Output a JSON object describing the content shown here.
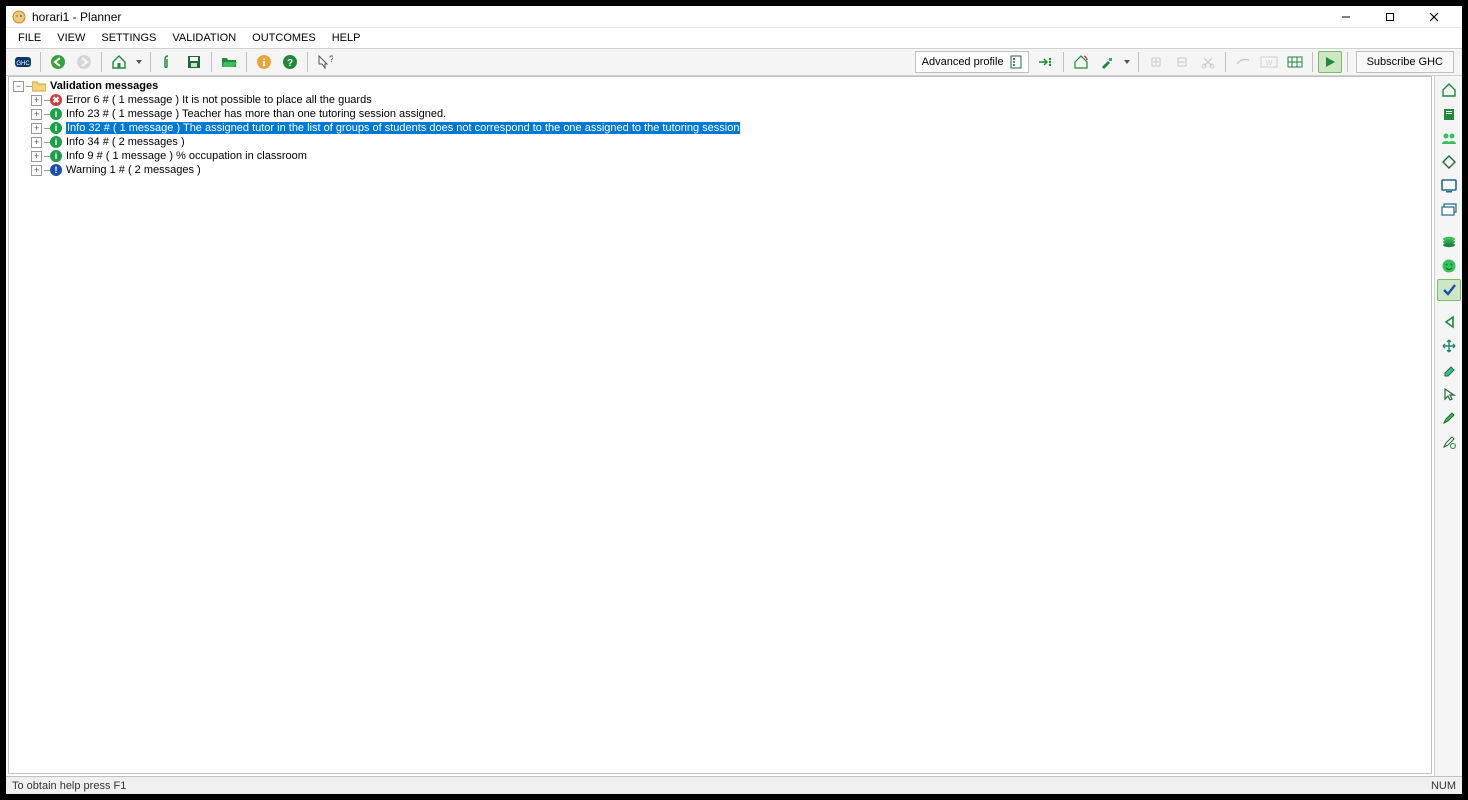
{
  "window": {
    "title": "horari1 - Planner"
  },
  "menus": {
    "file": "FILE",
    "view": "VIEW",
    "settings": "SETTINGS",
    "validation": "VALIDATION",
    "outcomes": "OUTCOMES",
    "help": "HELP"
  },
  "toolbar": {
    "advanced_profile": "Advanced profile",
    "subscribe": "Subscribe GHC"
  },
  "tree": {
    "root": "Validation messages",
    "items": [
      {
        "sev": "error",
        "text": "Error 6 # ( 1 message )  It is not possible to place all the guards"
      },
      {
        "sev": "info",
        "text": "Info 23 # ( 1 message )  Teacher  has more than one tutoring session assigned."
      },
      {
        "sev": "info",
        "text": "Info 32 # ( 1 message )  The assigned tutor in the list of groups of students  does not correspond to the one assigned to the tutoring session",
        "selected": true
      },
      {
        "sev": "info",
        "text": "Info 34 # ( 2 messages )"
      },
      {
        "sev": "info",
        "text": "Info 9 # ( 1 message )  % occupation in classroom"
      },
      {
        "sev": "warn",
        "text": "Warning 1 # ( 2 messages )"
      }
    ]
  },
  "status": {
    "help": "To obtain help press F1",
    "num": "NUM"
  }
}
